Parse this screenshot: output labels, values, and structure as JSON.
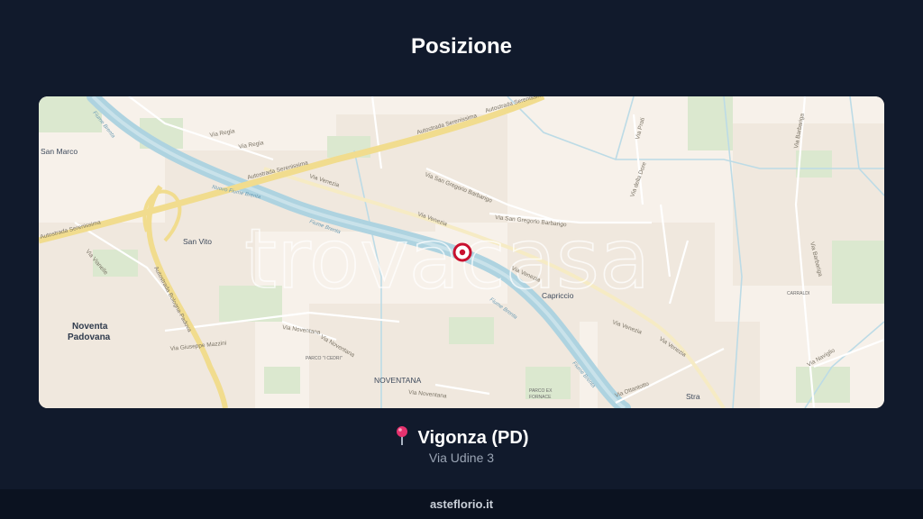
{
  "header": {
    "title": "Posizione"
  },
  "map": {
    "watermark": "trovacasa",
    "labels": {
      "san_marco": "San Marco",
      "san_vito": "San Vito",
      "noventa_1": "Noventa",
      "noventa_2": "Padovana",
      "capriccio": "Capriccio",
      "noventana": "NOVENTANA",
      "stra": "Stra",
      "via_regia_1": "Via Regia",
      "via_regia_2": "Via Regia",
      "autostrada_1": "Autostrada Serenissima",
      "autostrada_2": "Autostrada Serenissima",
      "autostrada_3": "Autostrada Serenissima",
      "autostrada_4": "Autostrada Serenissima",
      "autostrada_bologna": "Autostrada Bologna-Padova",
      "via_venezia_1": "Via Venezia",
      "via_venezia_2": "Via Venezia",
      "via_venezia_3": "Via Venezia",
      "via_venezia_4": "Via Venezia",
      "via_venezia_5": "Via Venezia",
      "via_san_gregorio_1": "Via San Gregorio Barbarigo",
      "via_san_gregorio_2": "Via San Gregorio Barbarigo",
      "via_noventana": "Via Noventana",
      "via_noventana_2": "Via Noventana",
      "via_noventana_3": "Via Noventana",
      "via_giuseppe_mazzini": "Via Giuseppe Mazzini",
      "via_barbariga": "Via Barbariga",
      "via_barbariga_2": "Via Barbariga",
      "via_naviglio": "Via Naviglio",
      "fiume_brenta_1": "Fiume Brenta",
      "fiume_brenta_2": "Fiume Brenta",
      "fiume_brenta_3": "Fiume Brenta",
      "fiume_brenta_4": "Fiume Brenta",
      "nuovo_fiume_brenta": "Nuovo Fiume Brenta",
      "via_vianelle": "Via Vianelle",
      "via_prati": "Via Prati",
      "via_della_dore": "Via della Dore",
      "parco_cedri": "PARCO \"I CEDRI\"",
      "parco_fornace_1": "PARCO EX",
      "parco_fornace_2": "FORNACE",
      "carraldi": "CARRALDI",
      "via_ottantotto": "Via Ottantotto"
    }
  },
  "location": {
    "city": "Vigonza (PD)",
    "address": "Via Udine 3"
  },
  "footer": {
    "site": "asteflorio.it"
  },
  "colors": {
    "background": "#111a2c",
    "map_base": "#f7f1ea",
    "river": "#aed3e0",
    "highway": "#f1dc8e",
    "marker": "#c8102e"
  }
}
